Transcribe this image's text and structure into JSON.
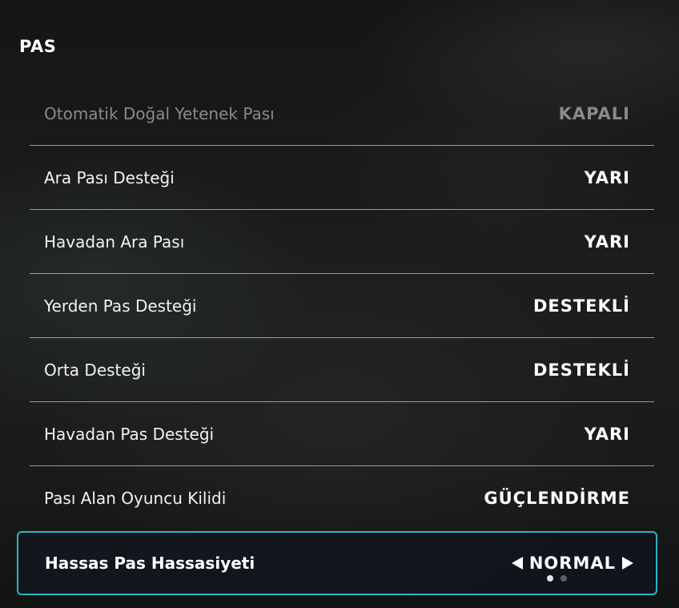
{
  "section": {
    "title": "PAS"
  },
  "settings": [
    {
      "label": "Otomatik Doğal Yetenek Pası",
      "value": "KAPALI",
      "disabled": true
    },
    {
      "label": "Ara Pası Desteği",
      "value": "YARI",
      "disabled": false
    },
    {
      "label": "Havadan Ara Pası",
      "value": "YARI",
      "disabled": false
    },
    {
      "label": "Yerden Pas Desteği",
      "value": "DESTEKLİ",
      "disabled": false
    },
    {
      "label": "Orta Desteği",
      "value": "DESTEKLİ",
      "disabled": false
    },
    {
      "label": "Havadan Pas Desteği",
      "value": "YARI",
      "disabled": false
    },
    {
      "label": "Pası Alan Oyuncu Kilidi",
      "value": "GÜÇLENDİRME",
      "disabled": false
    }
  ],
  "selected_setting": {
    "label": "Hassas Pas Hassasiyeti",
    "value": "NORMAL",
    "page_indicator": {
      "current": 1,
      "total": 2
    }
  },
  "colors": {
    "focus_border": "#2bb5c2",
    "disabled_text": "#8a8a8a",
    "text": "#ffffff"
  },
  "icons": {
    "previous": "triangle-left-icon",
    "next": "triangle-right-icon"
  }
}
